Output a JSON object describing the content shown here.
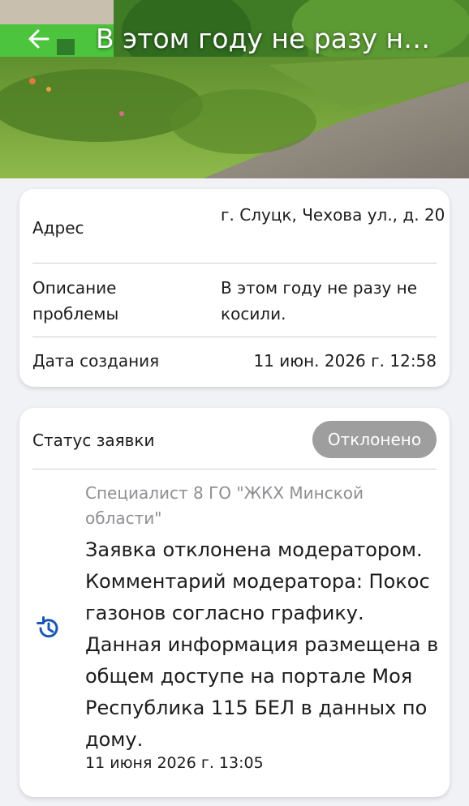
{
  "header": {
    "title": "В этом году не разу не косили.",
    "back_icon": "arrow-left-icon"
  },
  "details": {
    "address_label": "Адрес",
    "address_value": "г. Слуцк, Чехова ул., д. 20",
    "description_label": "Описание проблемы",
    "description_value": "В этом году не разу не косили.",
    "created_label": "Дата создания",
    "created_value": "11 июн. 2026 г. 12:58"
  },
  "status": {
    "label": "Статус заявки",
    "badge": "Отклонено",
    "badge_color": "#9e9e9e"
  },
  "history": {
    "icon": "history-icon",
    "author": "Специалист 8 ГО \"ЖКХ Минской области\"",
    "comment": "Заявка отклонена модератором. Комментарий модератора: Покос газонов согласно графику. Данная информация размещена в общем доступе на портале Моя Республика 115 БЕЛ в данных по дому.",
    "timestamp": "11 июня 2026 г. 13:05",
    "accent_color": "#1a56b8"
  }
}
